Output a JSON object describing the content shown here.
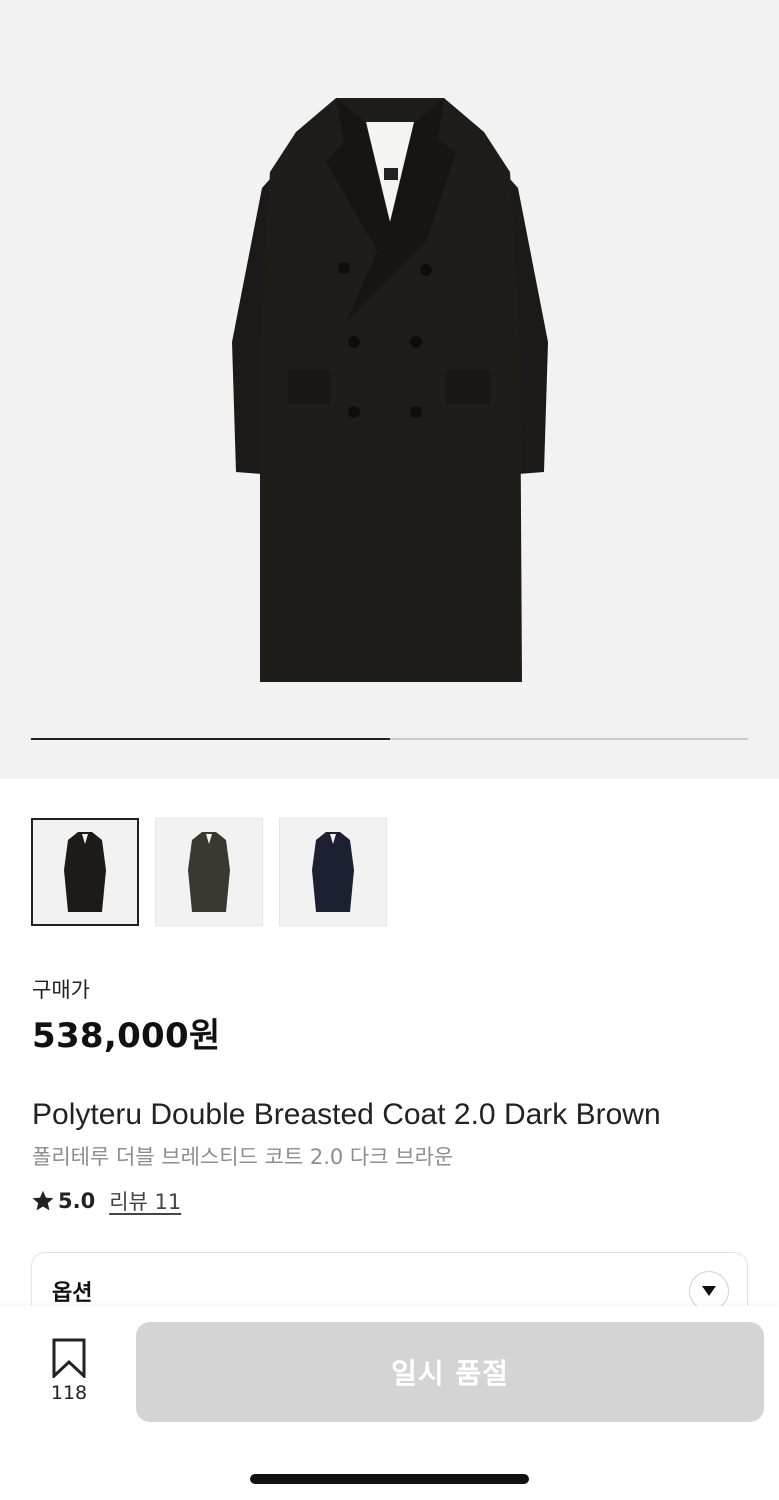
{
  "gallery": {
    "current_fraction": 0.5,
    "thumbnails": [
      {
        "icon": "coat-thumbnail-icon",
        "color": "#1c1b19"
      },
      {
        "icon": "coat-thumbnail-icon",
        "color": "#3a3830"
      },
      {
        "icon": "coat-thumbnail-icon",
        "color": "#1d2030"
      }
    ]
  },
  "price": {
    "label": "구매가",
    "value": "538,000원"
  },
  "product": {
    "title_en": "Polyteru Double Breasted Coat 2.0 Dark Brown",
    "title_ko": "폴리테루 더블 브레스티드 코트 2.0 다크 브라운"
  },
  "rating": {
    "icon": "star-icon",
    "score": "5.0",
    "review_label": "리뷰 11"
  },
  "options": {
    "label": "옵션",
    "toggle_icon": "chevron-down-icon"
  },
  "bottom_bar": {
    "bookmark_icon": "bookmark-icon",
    "bookmark_count": "118",
    "button_label": "일시 품절"
  },
  "colors": {
    "button_disabled": "#d4d4d4",
    "coat": "#1e1d1a"
  }
}
